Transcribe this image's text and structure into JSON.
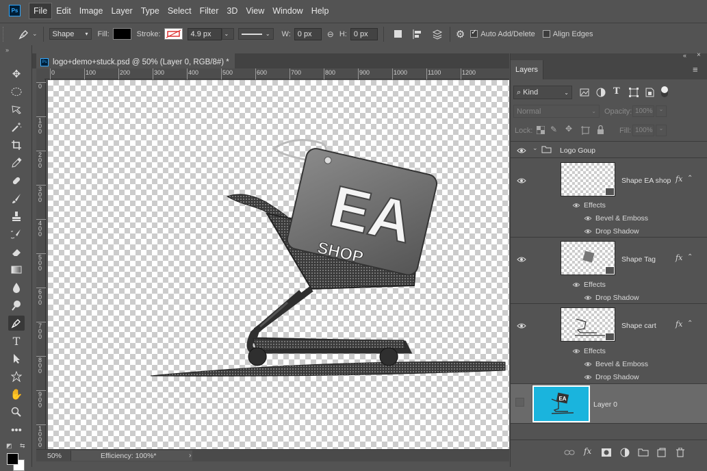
{
  "menubar": {
    "logo": "Ps",
    "items": [
      "File",
      "Edit",
      "Image",
      "Layer",
      "Type",
      "Select",
      "Filter",
      "3D",
      "View",
      "Window",
      "Help"
    ]
  },
  "options": {
    "mode_value": "Shape",
    "fill_label": "Fill:",
    "stroke_label": "Stroke:",
    "stroke_width": "4.9 px",
    "w_label": "W:",
    "w_value": "0 px",
    "h_label": "H:",
    "h_value": "0 px",
    "auto_add_label": "Auto Add/Delete",
    "align_edges_label": "Align Edges",
    "auto_add_checked": true,
    "align_edges_checked": false,
    "fill_color": "#000000",
    "accent_color": "#31a8ff"
  },
  "document": {
    "tab_title": "logo+demo+stuck.psd @ 50% (Layer 0, RGB/8#) *",
    "ruler_h": [
      "0",
      "100",
      "200",
      "300",
      "400",
      "500",
      "600",
      "700",
      "800",
      "900",
      "1000",
      "1100",
      "1200"
    ],
    "ruler_v": [
      "0",
      "1 0 0",
      "2 0 0",
      "3 0 0",
      "4 0 0",
      "5 0 0",
      "6 0 0",
      "7 0 0",
      "8 0 0",
      "9 0 0",
      "1 0 0 0"
    ],
    "zoom": "50%",
    "efficiency": "Efficiency: 100%*",
    "artwork": {
      "tag_text_top": "EA",
      "tag_text_bottom": "SHOP"
    }
  },
  "layers_panel": {
    "tab_label": "Layers",
    "kind_label": "Kind",
    "blend_mode": "Normal",
    "opacity_label": "Opacity:",
    "opacity_value": "100%",
    "lock_label": "Lock:",
    "fill_label": "Fill:",
    "fill_value": "100%",
    "group_name": "Logo Goup",
    "layers": [
      {
        "name": "Shape EA shop",
        "effects_label": "Effects",
        "effects": [
          "Bevel & Emboss",
          "Drop Shadow"
        ]
      },
      {
        "name": "Shape Tag",
        "effects_label": "Effects",
        "effects": [
          "Drop Shadow"
        ]
      },
      {
        "name": "Shape cart",
        "effects_label": "Effects",
        "effects": [
          "Bevel & Emboss",
          "Drop Shadow"
        ]
      },
      {
        "name": "Layer 0",
        "thumb_color": "#1ab4dd"
      }
    ],
    "fx_symbol": "fx"
  }
}
